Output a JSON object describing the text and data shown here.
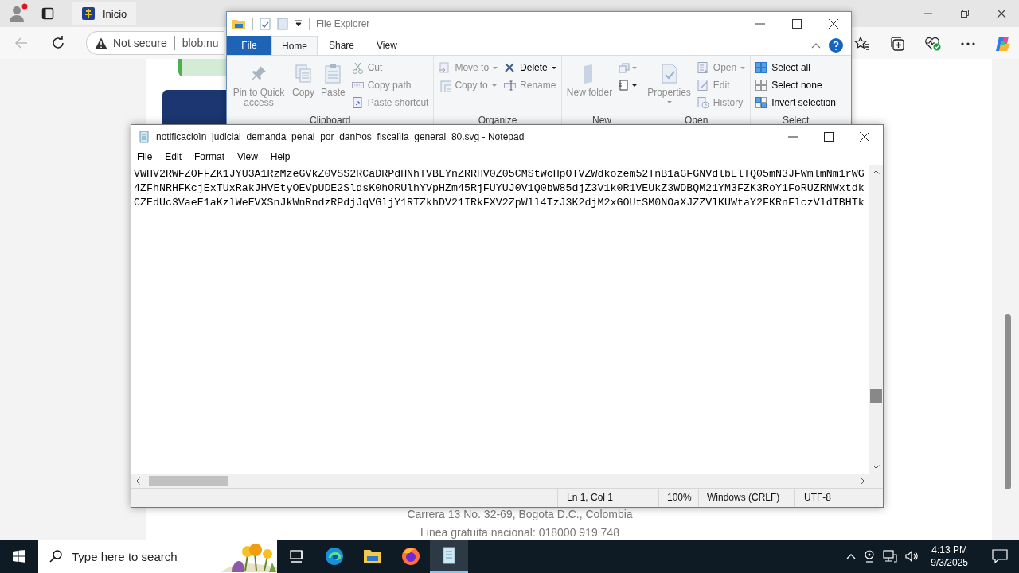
{
  "browser": {
    "tabs": [
      {
        "title": "Inicio",
        "kind": "site",
        "selected": true
      }
    ],
    "address": {
      "security": "Not secure",
      "url": "blob:nu"
    },
    "page": {
      "footer_lines": [
        "Carrera 13 No. 32-69, Bogota D.C., Colombia",
        "Linea gratuita nacional: 018000 919 748"
      ]
    }
  },
  "file_explorer": {
    "title": "File Explorer",
    "tabs": [
      {
        "label": "File",
        "kind": "file",
        "selected": false
      },
      {
        "label": "Home",
        "kind": "tab",
        "selected": true
      },
      {
        "label": "Share",
        "kind": "tab",
        "selected": false
      },
      {
        "label": "View",
        "kind": "tab",
        "selected": false
      }
    ],
    "groups": [
      {
        "label": "Clipboard",
        "columns": [
          [
            {
              "kind": "large",
              "label": "Pin to Quick access",
              "disabled": true
            }
          ],
          [
            {
              "kind": "large",
              "label": "Copy",
              "disabled": true
            }
          ],
          [
            {
              "kind": "large",
              "label": "Paste",
              "disabled": true
            }
          ],
          [
            {
              "kind": "small",
              "label": "Cut",
              "disabled": true
            },
            {
              "kind": "small",
              "label": "Copy path",
              "disabled": true
            },
            {
              "kind": "small",
              "label": "Paste shortcut",
              "disabled": true
            }
          ]
        ]
      },
      {
        "label": "Organize",
        "columns": [
          [
            {
              "kind": "small",
              "label": "Move to",
              "menu": true,
              "disabled": true
            },
            {
              "kind": "small",
              "label": "Copy to",
              "menu": true,
              "disabled": true
            }
          ],
          [
            {
              "kind": "small",
              "label": "Delete",
              "menu": true,
              "disabled": false
            },
            {
              "kind": "small",
              "label": "Rename",
              "disabled": true
            }
          ]
        ]
      },
      {
        "label": "New",
        "columns": [
          [
            {
              "kind": "large",
              "label": "New folder",
              "disabled": true
            }
          ],
          [
            {
              "kind": "icon",
              "menu": true,
              "disabled": true
            },
            {
              "kind": "icon",
              "menu": true,
              "disabled": false
            }
          ]
        ]
      },
      {
        "label": "Open",
        "columns": [
          [
            {
              "kind": "large",
              "label": "Properties",
              "menu": true,
              "disabled": true
            }
          ],
          [
            {
              "kind": "small",
              "label": "Open",
              "menu": true,
              "disabled": true
            },
            {
              "kind": "small",
              "label": "Edit",
              "disabled": true
            },
            {
              "kind": "small",
              "label": "History",
              "disabled": true
            }
          ]
        ]
      },
      {
        "label": "Select",
        "columns": [
          [
            {
              "kind": "small",
              "label": "Select all",
              "disabled": false
            },
            {
              "kind": "small",
              "label": "Select none",
              "disabled": false
            },
            {
              "kind": "small",
              "label": "Invert selection",
              "disabled": false
            }
          ]
        ]
      }
    ]
  },
  "notepad": {
    "title": "notificacioìn_judicial_demanda_penal_por_danÞos_fiscalìia_general_80.svg - Notepad",
    "menu": [
      "File",
      "Edit",
      "Format",
      "View",
      "Help"
    ],
    "lines": [
      "VWHV2RWFZOFFZK1JYU3A1RzMzeGVkZ0VSS2RCaDRPdHNhTVBLYnZRRHV0Z05CMStWcHpOTVZWdkozem52TnB1aGFGNVdlbElTQ05mN3JFWmlmNm1rWG",
      "4ZFhNRHFKcjExTUxRakJHVEtyOEVpUDE2SldsK0hORUlhYVpHZm45RjFUYUJ0V1Q0bW85djZ3V1k0R1VEUkZ3WDBQM21YM3FZK3RoY1FoRUZRNWxtdk",
      "CZEdUc3VaeE1aKzlWeEVXSnJkWnRndzRPdjJqVGljY1RTZkhDV21IRkFXV2ZpWll4TzJ3K2djM2xGOUtSM0NOaXJZZVlKUWtaY2FKRnFlczVldTBHTk"
    ],
    "status": [
      "Ln 1, Col 1",
      "100%",
      "Windows (CRLF)",
      "UTF-8"
    ]
  },
  "taskbar": {
    "search_placeholder": "Type here to search",
    "apps": [
      {
        "kind": "taskview",
        "active": false
      },
      {
        "kind": "edge",
        "active": false
      },
      {
        "kind": "explorer",
        "active": false
      },
      {
        "kind": "firefox",
        "active": false
      },
      {
        "kind": "notepad",
        "active": true
      }
    ],
    "time": "4:13 PM",
    "date": "9/3/2025"
  }
}
